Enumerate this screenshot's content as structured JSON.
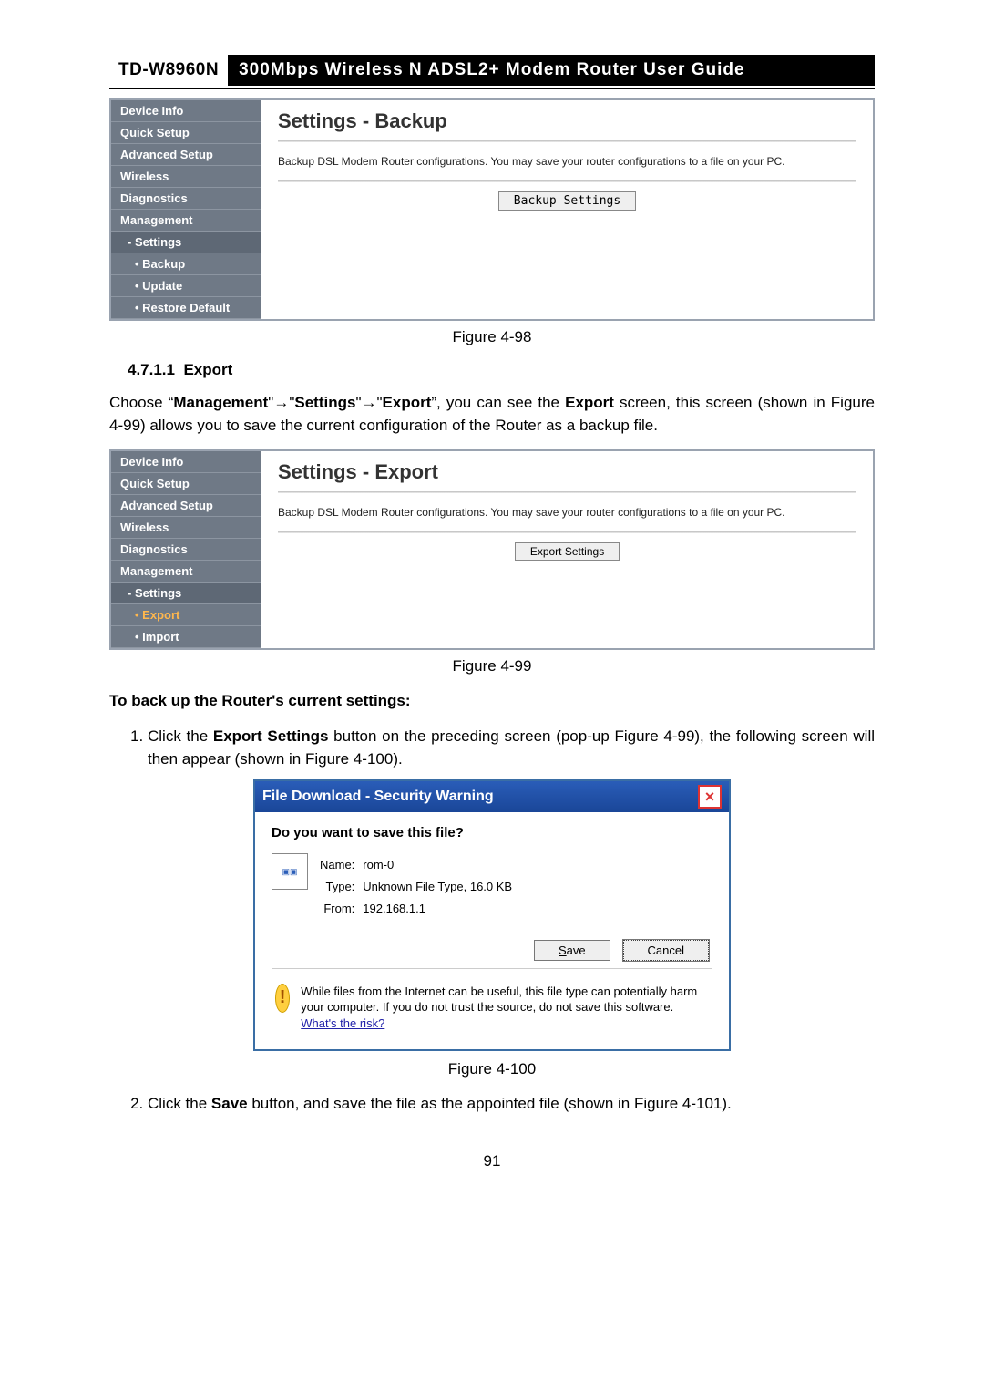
{
  "header": {
    "model": "TD-W8960N",
    "title": "300Mbps Wireless N ADSL2+ Modem Router User Guide"
  },
  "fig1": {
    "sidebar": [
      "Device Info",
      "Quick Setup",
      "Advanced Setup",
      "Wireless",
      "Diagnostics",
      "Management"
    ],
    "sidebar_sub1": "Settings",
    "sidebar_sub2": [
      "Backup",
      "Update",
      "Restore Default"
    ],
    "title": "Settings - Backup",
    "desc": "Backup DSL Modem Router configurations. You may save your router configurations to a file on your PC.",
    "button": "Backup Settings",
    "caption": "Figure 4-98"
  },
  "section": {
    "num": "4.7.1.1",
    "title": "Export",
    "para_pre": "Choose “",
    "nav1": "Management",
    "nav2": "Settings",
    "nav3": "Export",
    "para_mid": "”, you can see the ",
    "export_bold": "Export",
    "para_tail": " screen, this screen (shown in Figure 4-99) allows you to save the current configuration of the Router as a backup file."
  },
  "fig2": {
    "sidebar": [
      "Device Info",
      "Quick Setup",
      "Advanced Setup",
      "Wireless",
      "Diagnostics",
      "Management"
    ],
    "sidebar_sub1": "Settings",
    "sidebar_sub2": [
      "Export",
      "Import"
    ],
    "title": "Settings - Export",
    "desc": "Backup DSL Modem Router configurations. You may save your router configurations to a file on your PC.",
    "button": "Export Settings",
    "caption": "Figure 4-99"
  },
  "backup_heading": "To back up the Router's current settings:",
  "step1": {
    "pre": "Click the ",
    "bold": "Export Settings",
    "rest": " button on the preceding screen (pop-up Figure 4-99), the following screen will then appear (shown in Figure 4-100)."
  },
  "dialog": {
    "title": "File Download - Security Warning",
    "question": "Do you want to save this file?",
    "name_lbl": "Name:",
    "name_val": "rom-0",
    "type_lbl": "Type:",
    "type_val": "Unknown File Type, 16.0 KB",
    "from_lbl": "From:",
    "from_val": "192.168.1.1",
    "save": "Save",
    "cancel": "Cancel",
    "warn_a": "While files from the Internet can be useful, this file type can potentially harm your computer. If you do not trust the source, do not save this software. ",
    "warn_link": "What's the risk?",
    "caption": "Figure 4-100"
  },
  "step2": {
    "pre": "Click the ",
    "bold": "Save",
    "rest": " button, and save the file as the appointed file (shown in Figure 4-101)."
  },
  "pagenum": "91"
}
